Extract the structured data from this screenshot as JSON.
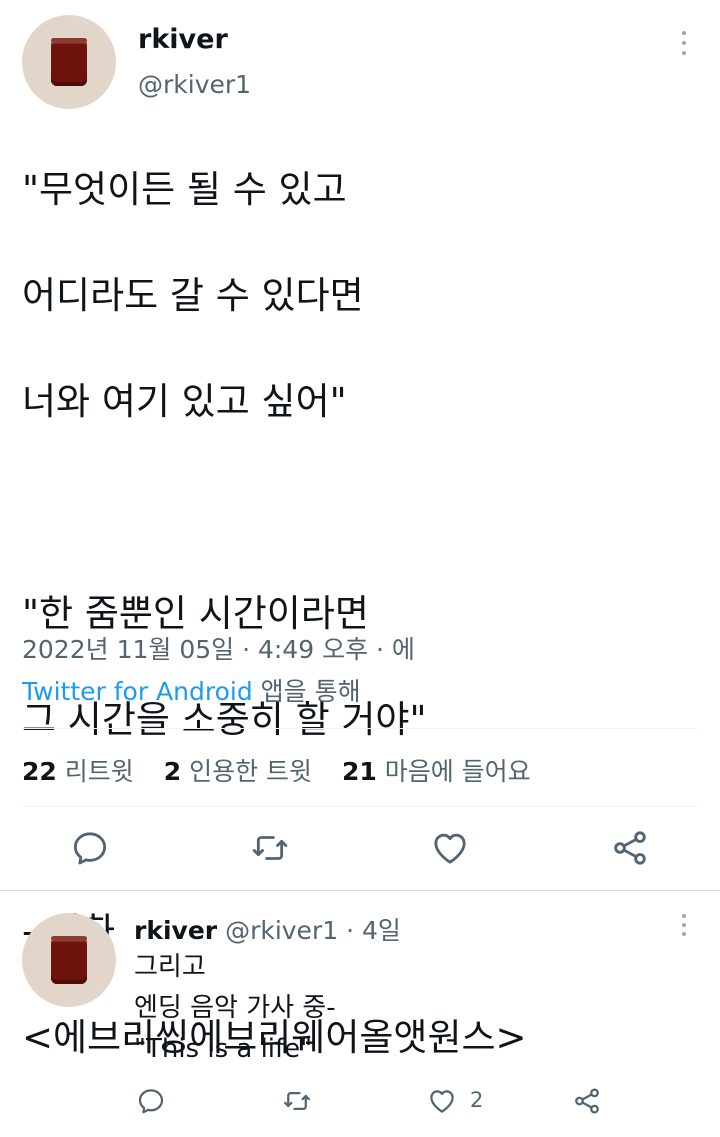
{
  "main_tweet": {
    "display_name": "rkiver",
    "handle": "@rkiver1",
    "text_lines": [
      "\"무엇이든 될 수 있고",
      "어디라도 갈 수 있다면",
      "너와 여기 있고 싶어\"",
      "",
      "\"한 줌뿐인 시간이라면",
      "그 시간을 소중히 할 거야\"",
      "",
      "- 영화",
      "<에브리씽에브리웨어올앳원스>"
    ],
    "timestamp": "2022년 11월 05일 · 4:49 오후 · 에",
    "source_app": "Twitter for Android",
    "source_suffix": " 앱을 통해",
    "stats": {
      "retweets_count": "22",
      "retweets_label": "리트윗",
      "quotes_count": "2",
      "quotes_label": "인용한 트윗",
      "likes_count": "21",
      "likes_label": "마음에 들어요"
    }
  },
  "reply": {
    "display_name": "rkiver",
    "handle_time": "@rkiver1 · 4일",
    "text_lines": [
      "그리고",
      "엔딩 음악 가사 중-",
      "\"This is a life\""
    ],
    "like_count": "2"
  },
  "icons": {
    "reply": "reply-icon",
    "retweet": "retweet-icon",
    "like": "heart-icon",
    "share": "share-icon",
    "more": "more-vertical-icon"
  },
  "colors": {
    "accent": "#1d9bf0",
    "text": "#0f1419",
    "muted": "#536471",
    "icon": "#536471"
  }
}
